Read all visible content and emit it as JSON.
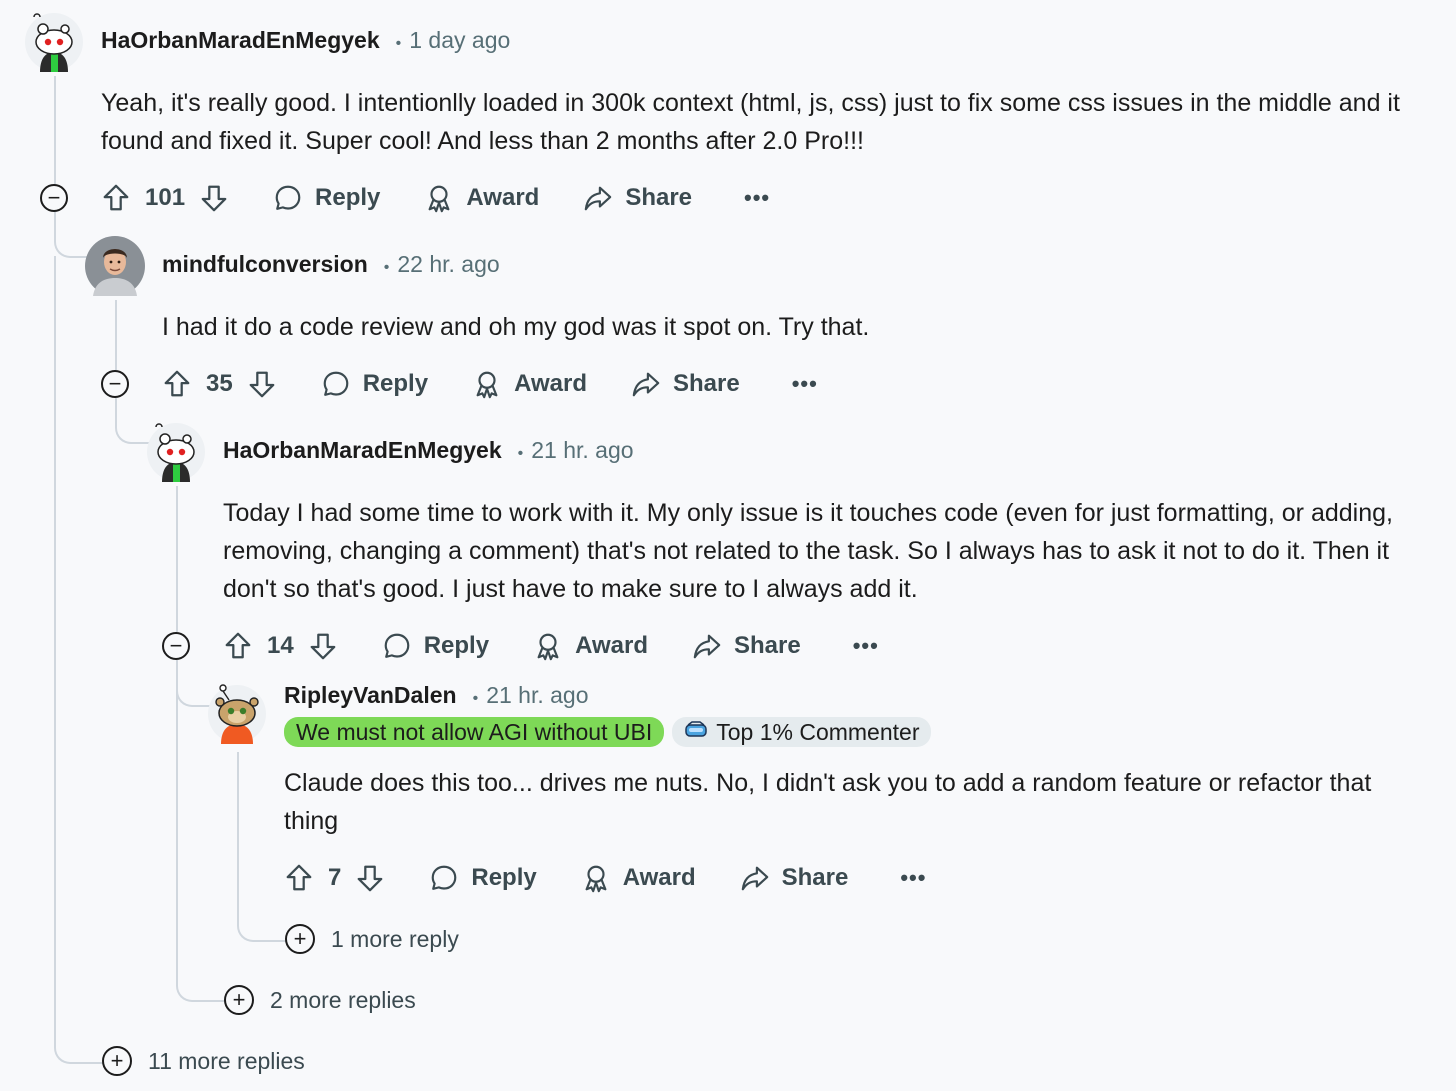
{
  "comments": [
    {
      "username": "HaOrbanMaradEnMegyek",
      "separator": "•",
      "time": "1 day ago",
      "body": "Yeah, it's really good. I intentionlly loaded in 300k context (html, js, css) just to fix some css issues in the middle and it found and fixed it. Super cool! And less than 2 months after 2.0 Pro!!!",
      "votes": "101"
    },
    {
      "username": "mindfulconversion",
      "separator": "•",
      "time": "22 hr. ago",
      "body": "I had it do a code review and oh my god was it spot on. Try that.",
      "votes": "35"
    },
    {
      "username": "HaOrbanMaradEnMegyek",
      "separator": "•",
      "time": "21 hr. ago",
      "body": "Today I had some time to work with it. My only issue is it touches code (even for just formatting, or adding, removing, changing a comment) that's not related to the task. So I always has to ask it not to do it. Then it don't so that's good. I just have to make sure to I always add it.",
      "votes": "14"
    },
    {
      "username": "RipleyVanDalen",
      "separator": "•",
      "time": "21 hr. ago",
      "flair": "We must not allow AGI without UBI",
      "badge": "Top 1% Commenter",
      "body": "Claude does this too... drives me nuts. No, I didn't ask you to add a random feature or refactor that thing",
      "votes": "7"
    }
  ],
  "actions": {
    "reply": "Reply",
    "award": "Award",
    "share": "Share",
    "more": "•••"
  },
  "more_replies": {
    "level4": "1 more reply",
    "level3": "2 more replies",
    "level1": "11 more replies"
  },
  "icons": {
    "upvote": "upvote-arrow-icon",
    "downvote": "downvote-arrow-icon",
    "reply": "speech-bubble-icon",
    "award": "award-ribbon-icon",
    "share": "share-arrow-icon",
    "collapse": "minus-circle-icon",
    "expand": "plus-circle-icon",
    "badge": "vr-goggles-icon"
  },
  "colors": {
    "background": "#f8f9fb",
    "meta_text": "#576f76",
    "flair_green": "#7ed957",
    "badge_bg": "#e5ebee",
    "thread_line": "#d0d7de"
  }
}
